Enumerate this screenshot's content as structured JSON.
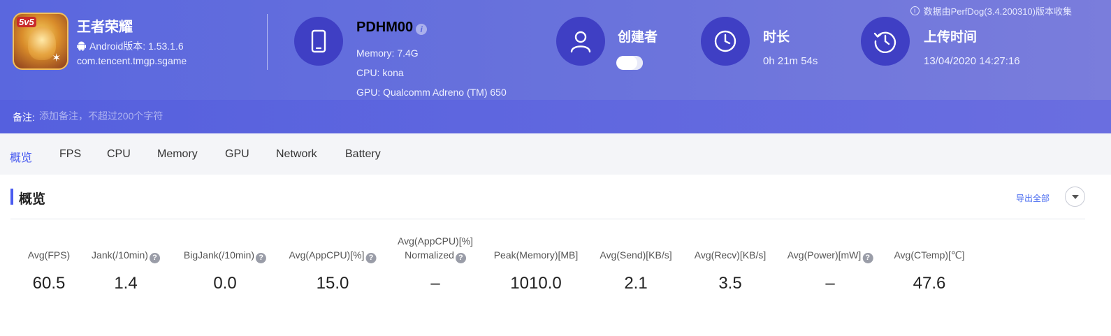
{
  "app": {
    "name": "王者荣耀",
    "badge": "5v5",
    "version": "Android版本: 1.53.1.6",
    "package": "com.tencent.tmgp.sgame"
  },
  "device": {
    "model": "PDHM00",
    "info_icon": "i",
    "memory": "Memory: 7.4G",
    "cpu": "CPU: kona",
    "gpu": "GPU: Qualcomm Adreno (TM) 650"
  },
  "creator": {
    "title": "创建者"
  },
  "duration": {
    "title": "时长",
    "value": "0h 21m 54s"
  },
  "upload": {
    "title": "上传时间",
    "value": "13/04/2020 14:27:16"
  },
  "source_notice": "数据由PerfDog(3.4.200310)版本收集",
  "remark": {
    "label": "备注:",
    "placeholder": "添加备注，不超过200个字符"
  },
  "tabs": [
    "概览",
    "FPS",
    "CPU",
    "Memory",
    "GPU",
    "Network",
    "Battery"
  ],
  "section": {
    "title": "概览",
    "export_label": "导出全部"
  },
  "metrics": [
    {
      "label": "Avg(FPS)",
      "value": "60.5",
      "help": false
    },
    {
      "label": "Jank(/10min)",
      "value": "1.4",
      "help": true
    },
    {
      "label": "BigJank(/10min)",
      "value": "0.0",
      "help": true
    },
    {
      "label": "Avg(AppCPU)[%]",
      "value": "15.0",
      "help": true
    },
    {
      "label": "Avg(AppCPU)[%]",
      "label2": "Normalized",
      "value": "–",
      "help": true
    },
    {
      "label": "Peak(Memory)[MB]",
      "value": "1010.0",
      "help": false
    },
    {
      "label": "Avg(Send)[KB/s]",
      "value": "2.1",
      "help": false
    },
    {
      "label": "Avg(Recv)[KB/s]",
      "value": "3.5",
      "help": false
    },
    {
      "label": "Avg(Power)[mW]",
      "value": "–",
      "help": true
    },
    {
      "label": "Avg(CTemp)[℃]",
      "value": "47.6",
      "help": false
    }
  ],
  "colors": {
    "accent": "#4a5cf0",
    "header": "#5a67de",
    "icon_circle": "#3f3fc4"
  }
}
